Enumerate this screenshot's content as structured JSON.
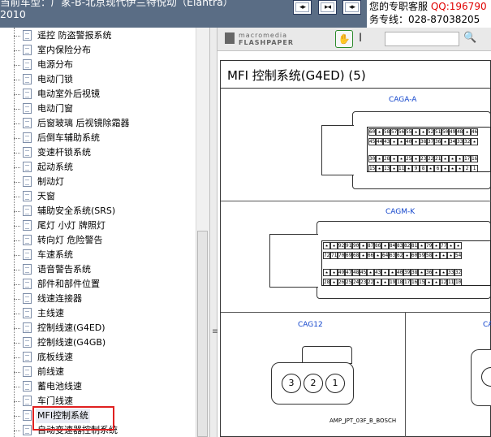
{
  "header": {
    "title": "当前车型：厂家-B-北京现代伊兰特悦动（Elantra）\n2010",
    "nav_buttons": [
      "prev-page",
      "first-last",
      "next-page"
    ],
    "service_line1_prefix": "您的专职客服",
    "service_line1_qq": "QQ:196790",
    "service_line2": "务专线：028-87038205"
  },
  "sidebar": {
    "items": [
      {
        "label": "遥控 防盗警报系统"
      },
      {
        "label": "室内保险分布"
      },
      {
        "label": "电源分布"
      },
      {
        "label": "电动门锁"
      },
      {
        "label": "电动室外后视镜"
      },
      {
        "label": "电动门窗"
      },
      {
        "label": "后窗玻璃 后视镜除霜器"
      },
      {
        "label": "后倒车辅助系统"
      },
      {
        "label": "变速杆锁系统"
      },
      {
        "label": "起动系统"
      },
      {
        "label": "制动灯"
      },
      {
        "label": "天窗"
      },
      {
        "label": "辅助安全系统(SRS)"
      },
      {
        "label": "尾灯 小灯 牌照灯"
      },
      {
        "label": "转向灯 危险警告"
      },
      {
        "label": "车速系统"
      },
      {
        "label": "语音警告系统"
      },
      {
        "label": "部件和部件位置"
      },
      {
        "label": "线速连接器"
      },
      {
        "label": "主线速"
      },
      {
        "label": "控制线速(G4ED)"
      },
      {
        "label": "控制线速(G4GB)"
      },
      {
        "label": "底板线速"
      },
      {
        "label": "前线速"
      },
      {
        "label": "蓄电池线速"
      },
      {
        "label": "车门线速"
      },
      {
        "label": "MFI控制系统",
        "selected": true
      },
      {
        "label": "自动变速器控制系统"
      }
    ]
  },
  "viewer": {
    "toolbar": {
      "brand_line1": "macromedia",
      "brand_line2": "FLASHPAPER",
      "hand_tool": "hand-tool",
      "text_tool": "text-select-tool",
      "search_value": ""
    },
    "page": {
      "title": "MFI 控制系统(G4ED) (5)",
      "connectors": [
        {
          "label": "CAGA-A",
          "rows": [
            [
              "60",
              "★",
              "58",
              "57",
              "56",
              "55",
              "★",
              "★",
              "52",
              "51",
              "50",
              "49",
              "48",
              "★",
              "46"
            ],
            [
              "45",
              "44",
              "43",
              "★",
              "★",
              "40",
              "★",
              "38",
              "37",
              "36",
              "★",
              "34",
              "33",
              "32",
              "★"
            ],
            [
              "30",
              "★",
              "28",
              "★",
              "★",
              "25",
              "★",
              "23",
              "22",
              "21",
              "★",
              "★",
              "★",
              "17",
              "16"
            ],
            [
              "15",
              "★",
              "13",
              "★",
              "11",
              "★",
              "9",
              "8",
              "★",
              "6",
              "★",
              "★",
              "★",
              "2",
              "1"
            ]
          ]
        },
        {
          "label": "CAGM-K",
          "rows": [
            [
              "★",
              "★",
              "92",
              "91",
              "90",
              "★",
              "87",
              "86",
              "★",
              "84",
              "83",
              "82",
              "81",
              "★",
              "79",
              "★",
              "77",
              "★",
              "★"
            ],
            [
              "72",
              "71",
              "70",
              "69",
              "68",
              "★",
              "66",
              "★",
              "64",
              "63",
              "62",
              "★",
              "60",
              "59",
              "58",
              "★",
              "★",
              "★",
              "54"
            ],
            [
              "★",
              "★",
              "49",
              "47",
              "48",
              "45",
              "★",
              "43",
              "★",
              "★",
              "40",
              "39",
              "38",
              "★",
              "36",
              "★",
              "★",
              "33",
              "32"
            ],
            [
              "28",
              "★",
              "26",
              "25",
              "24",
              "23",
              "22",
              "★",
              "★",
              "19",
              "18",
              "17",
              "16",
              "15",
              "★",
              "★",
              "12",
              "11",
              "10"
            ]
          ]
        },
        {
          "label": "CAG12",
          "pins": [
            "3",
            "2",
            "1"
          ],
          "part": "AMP_JPT_03F_B_BOSCH"
        },
        {
          "label": "CA"
        }
      ]
    }
  }
}
